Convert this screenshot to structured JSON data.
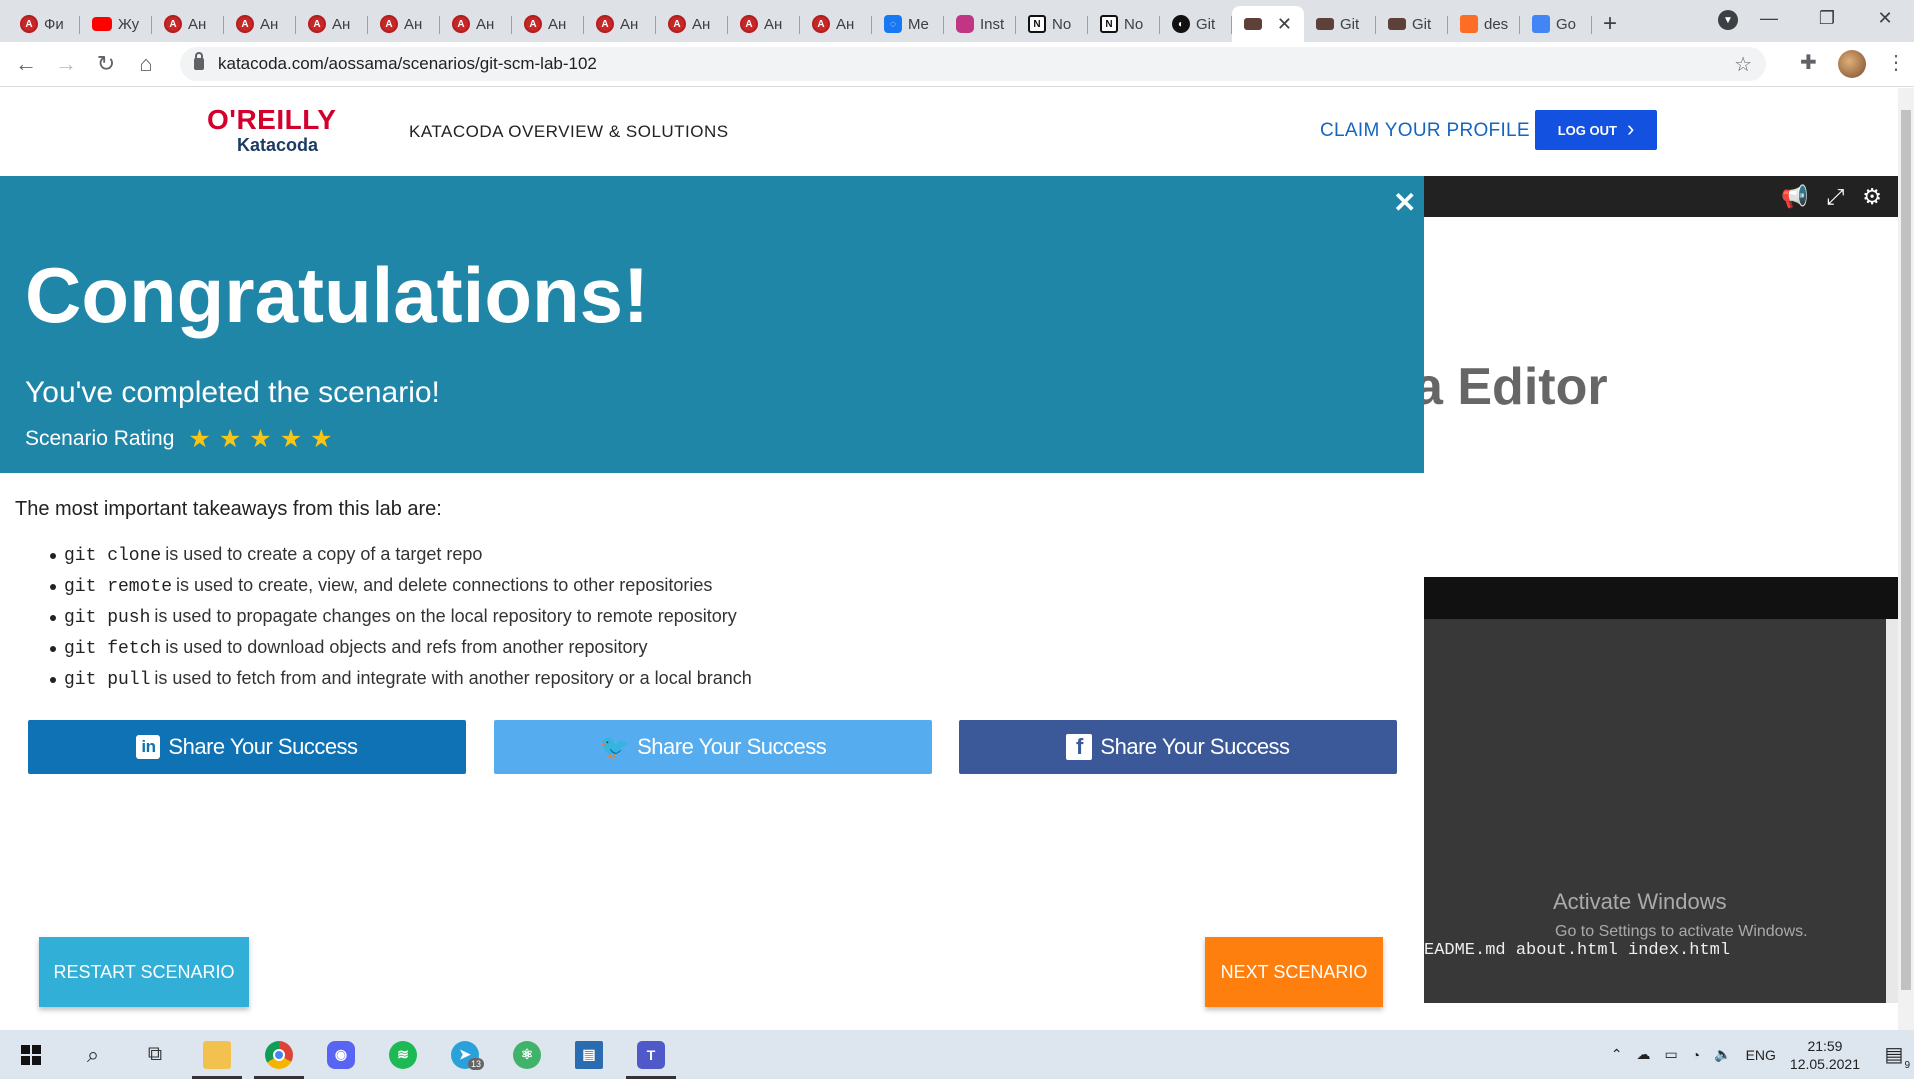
{
  "browser": {
    "tabs": [
      {
        "label": "Фи",
        "icon": "angular-icon"
      },
      {
        "label": "Жу",
        "icon": "youtube-icon"
      },
      {
        "label": "Ан",
        "icon": "angular-icon"
      },
      {
        "label": "Ан",
        "icon": "angular-icon"
      },
      {
        "label": "Ан",
        "icon": "angular-icon"
      },
      {
        "label": "Ан",
        "icon": "angular-icon"
      },
      {
        "label": "Ан",
        "icon": "angular-icon"
      },
      {
        "label": "Ан",
        "icon": "angular-icon"
      },
      {
        "label": "Ан",
        "icon": "angular-icon"
      },
      {
        "label": "Ан",
        "icon": "angular-icon"
      },
      {
        "label": "Ан",
        "icon": "angular-icon"
      },
      {
        "label": "Ан",
        "icon": "angular-icon"
      },
      {
        "label": "Me",
        "icon": "messenger-icon"
      },
      {
        "label": "Inst",
        "icon": "instagram-icon"
      },
      {
        "label": "No",
        "icon": "notion-icon"
      },
      {
        "label": "No",
        "icon": "notion-icon"
      },
      {
        "label": "Git",
        "icon": "github-icon"
      },
      {
        "label": "",
        "icon": "katacoda-icon",
        "active": true
      },
      {
        "label": "Git",
        "icon": "katacoda-icon"
      },
      {
        "label": "Git",
        "icon": "katacoda-icon"
      },
      {
        "label": "des",
        "icon": "gitlab-icon"
      },
      {
        "label": "Go",
        "icon": "google-translate-icon"
      }
    ],
    "url": "katacoda.com/aossama/scenarios/git-scm-lab-102"
  },
  "site": {
    "logo_top": "O'REILLY",
    "logo_bottom": "Katacoda",
    "nav_overview": "KATACODA OVERVIEW & SOLUTIONS",
    "claim_profile": "CLAIM YOUR PROFILE",
    "logout": "LOG OUT"
  },
  "modal": {
    "title": "Congratulations!",
    "subtitle": "You've completed the scenario!",
    "rating_label": "Scenario Rating",
    "rating_stars": 5,
    "takeaways_heading": "The most important takeaways from this lab are:",
    "takeaways": [
      {
        "code": "git clone",
        "text": "is used to create a copy of a target repo"
      },
      {
        "code": "git remote",
        "text": "is used to create, view, and delete connections to other repositories"
      },
      {
        "code": "git push",
        "text": "is used to propagate changes on the local repository to remote repository"
      },
      {
        "code": "git fetch",
        "text": "is used to download objects and refs from another repository"
      },
      {
        "code": "git pull",
        "text": "is used to fetch from and integrate with another repository or a local branch"
      }
    ],
    "share_linkedin": "Share Your Success",
    "share_twitter": "Share Your Success",
    "share_facebook": "Share Your Success",
    "restart": "RESTART SCENARIO",
    "next": "NEXT SCENARIO"
  },
  "right_panel": {
    "editor_title": "a Editor",
    "files": "EADME.md   about.html   index.html",
    "activate_title": "Activate Windows",
    "activate_sub": "Go to Settings to activate Windows."
  },
  "taskbar": {
    "language": "ENG",
    "time": "21:59",
    "date": "12.05.2021",
    "telegram_badge": "13",
    "notifications_badge": "9"
  },
  "colors": {
    "hero": "#1f86a8",
    "linkedin": "#0e72b5",
    "twitter": "#55acee",
    "facebook": "#3b5998",
    "restart": "#31afd6",
    "next": "#ff7f0e",
    "logout": "#1351e0"
  }
}
